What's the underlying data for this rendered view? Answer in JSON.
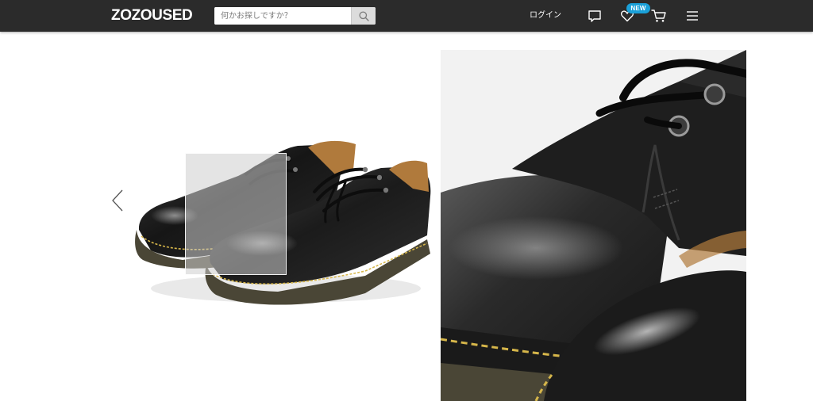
{
  "header": {
    "logo": "ZOZOUSED",
    "search": {
      "placeholder": "何かお探しですか？",
      "value": ""
    },
    "login_label": "ログイン",
    "badge_new": "NEW",
    "icons": {
      "search": "search-icon",
      "chat": "chat-bubble-icon",
      "favorites": "heart-icon",
      "cart": "cart-icon",
      "menu": "hamburger-menu-icon"
    }
  },
  "gallery": {
    "prev_icon": "chevron-left-icon",
    "main_image": "black leather lace-up shoes",
    "zoom_image": "close-up of shoe toe",
    "colors": {
      "leather": "#1c1c1c",
      "stitching": "#d6b64a",
      "sole": "#4a4636",
      "lining": "#b07a3c"
    }
  }
}
